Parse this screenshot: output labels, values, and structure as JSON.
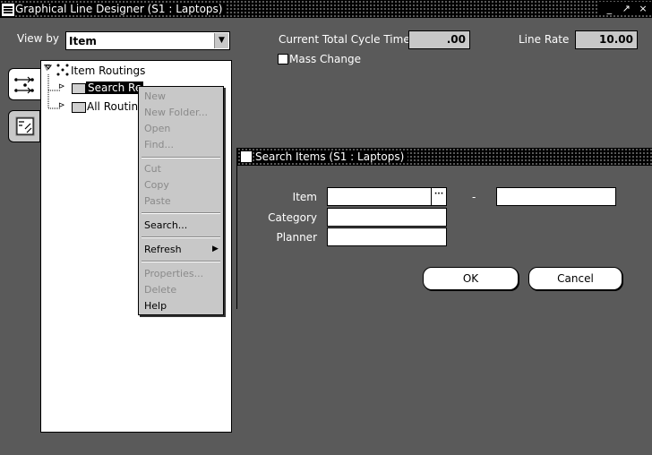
{
  "window": {
    "title": "Graphical Line Designer (S1 : Laptops)",
    "buttons": [
      "_",
      "↗",
      "×"
    ]
  },
  "header": {
    "view_by_label": "View by",
    "view_by_value": "Item",
    "cycle_time_label": "Current Total Cycle Time",
    "cycle_time_value": ".00",
    "line_rate_label": "Line Rate",
    "line_rate_value": "10.00",
    "mass_change_label": "Mass Change"
  },
  "tree": {
    "root": "Item Routings",
    "children": [
      "Search Re",
      "All Routing"
    ]
  },
  "context_menu": {
    "items": [
      {
        "label": "New",
        "enabled": false
      },
      {
        "label": "New Folder...",
        "enabled": false
      },
      {
        "label": "Open",
        "enabled": false
      },
      {
        "label": "Find...",
        "enabled": false
      },
      {
        "label": "Cut",
        "enabled": false
      },
      {
        "label": "Copy",
        "enabled": false
      },
      {
        "label": "Paste",
        "enabled": false
      },
      {
        "label": "Search...",
        "enabled": true
      },
      {
        "label": "Refresh",
        "enabled": true
      },
      {
        "label": "Properties...",
        "enabled": false
      },
      {
        "label": "Delete",
        "enabled": false
      },
      {
        "label": "Help",
        "enabled": true
      }
    ]
  },
  "dialog": {
    "title": "Search Items (S1 : Laptops)",
    "item_label": "Item",
    "range_separator": "-",
    "category_label": "Category",
    "planner_label": "Planner",
    "ok_label": "OK",
    "cancel_label": "Cancel"
  }
}
